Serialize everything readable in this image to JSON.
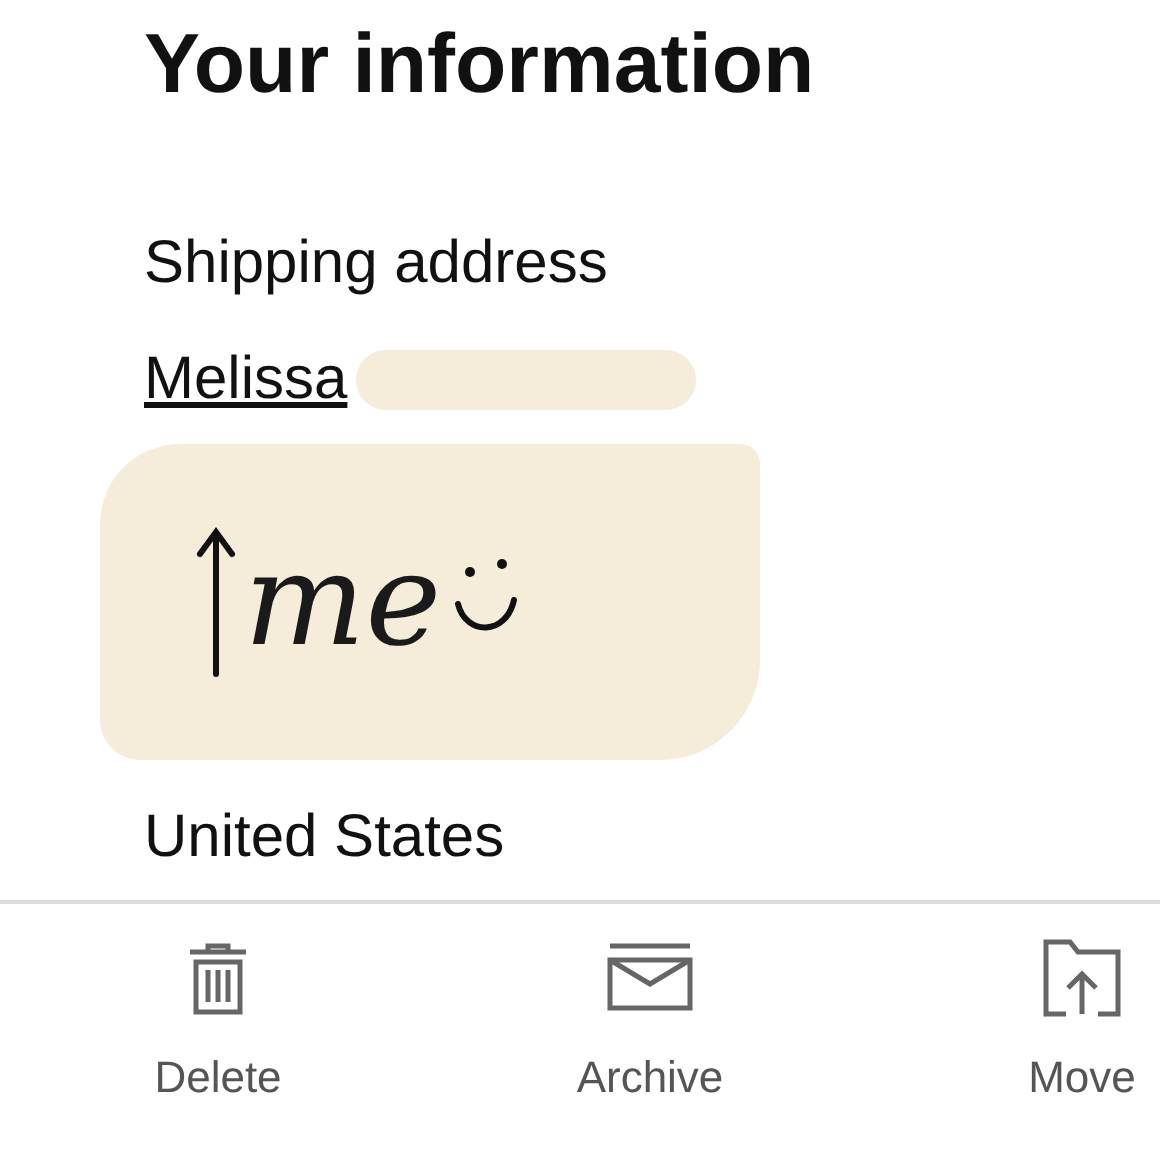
{
  "title": "Your information",
  "shipping": {
    "label": "Shipping address",
    "name": "Melissa",
    "annotation": "me",
    "country": "United States"
  },
  "toolbar": [
    {
      "kind": "delete",
      "label": "Delete"
    },
    {
      "kind": "archive",
      "label": "Archive"
    },
    {
      "kind": "move",
      "label": "Move"
    }
  ]
}
